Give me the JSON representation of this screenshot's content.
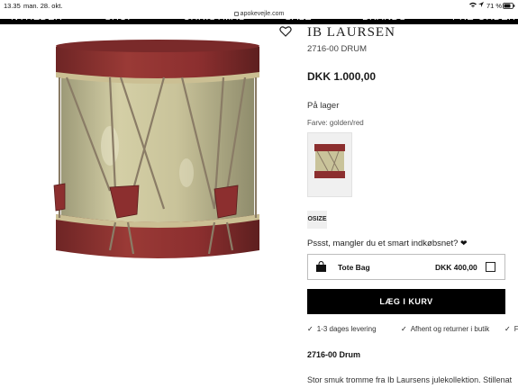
{
  "status_bar": {
    "time": "13.35",
    "date": "man. 28. okt.",
    "battery": "71 %",
    "url": "apokevejle.com"
  },
  "nav": {
    "items": [
      "NYHEDER",
      "SHOP",
      "CHRISTMAS",
      "SALE",
      "BRANDS",
      "PRE-ORDER"
    ]
  },
  "product": {
    "title": "IB LAURSEN",
    "sku": "2716-00 DRUM",
    "price": "DKK 1.000,00",
    "stock": "På lager",
    "color_label": "Farve:",
    "color_value": "golden/red",
    "size": "OSIZE"
  },
  "upsell": {
    "text": "Pssst, mangler du et smart indkøbsnet?",
    "heart": "❤",
    "item_name": "Tote Bag",
    "item_price": "DKK 400,00"
  },
  "cart_button": "LÆG I KURV",
  "usps": [
    "1-3 dages levering",
    "Afhent og returner i butik",
    "F"
  ],
  "description": {
    "title": "2716-00 Drum",
    "text": "Stor smuk tromme fra Ib Laursens julekollektion. Stillenat"
  },
  "colors": {
    "drum_red": "#8c2f2f",
    "drum_body": "#c9c39a",
    "black": "#000000"
  }
}
